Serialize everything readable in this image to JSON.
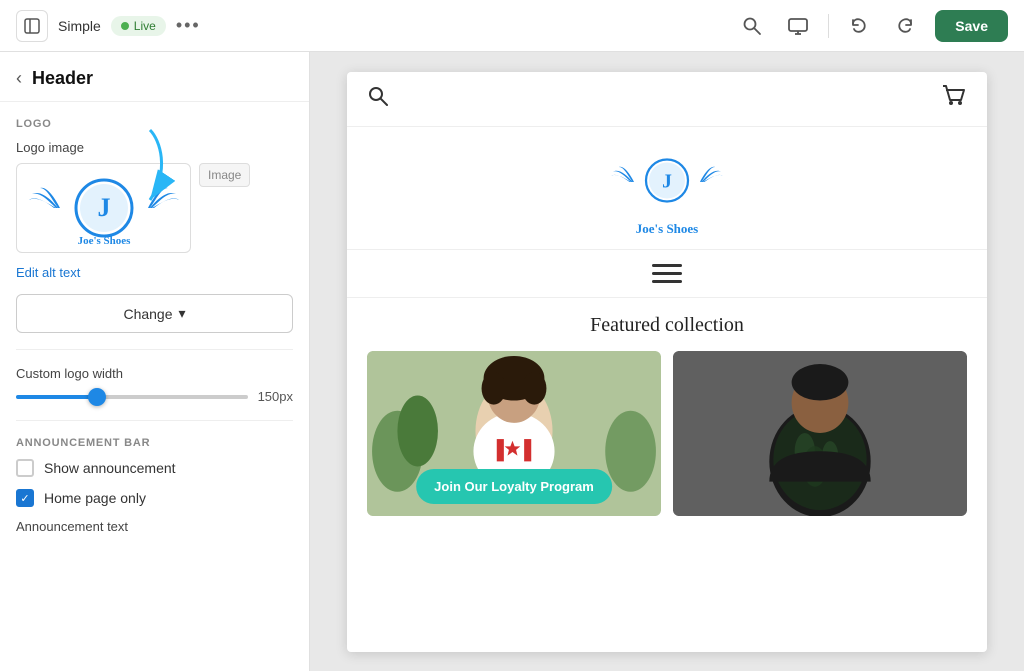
{
  "toolbar": {
    "exit_icon": "⊡",
    "site_name": "Simple",
    "live_label": "Live",
    "more_icon": "•••",
    "search_icon": "🔍",
    "monitor_icon": "🖥",
    "undo_icon": "↩",
    "redo_icon": "↪",
    "save_label": "Save"
  },
  "panel": {
    "back_label": "<",
    "title": "Header",
    "logo_section_label": "LOGO",
    "logo_image_label": "Logo image",
    "image_button_label": "Image",
    "edit_alt_text_label": "Edit alt text",
    "change_button_label": "Change",
    "change_arrow": "▾",
    "custom_logo_width_label": "Custom logo width",
    "slider_value": "150px",
    "announcement_bar_label": "ANNOUNCEMENT BAR",
    "show_announcement_label": "Show announcement",
    "home_page_only_label": "Home page only",
    "announcement_text_label": "Announcement text"
  },
  "preview": {
    "logo_name": "Joe's Shoes",
    "featured_collection_title": "Featured collection",
    "loyalty_button_label": "Join Our Loyalty Program"
  },
  "colors": {
    "accent_blue": "#1e88e5",
    "teal": "#26c6b0",
    "save_green": "#2e7d53",
    "live_green": "#4caf50"
  }
}
